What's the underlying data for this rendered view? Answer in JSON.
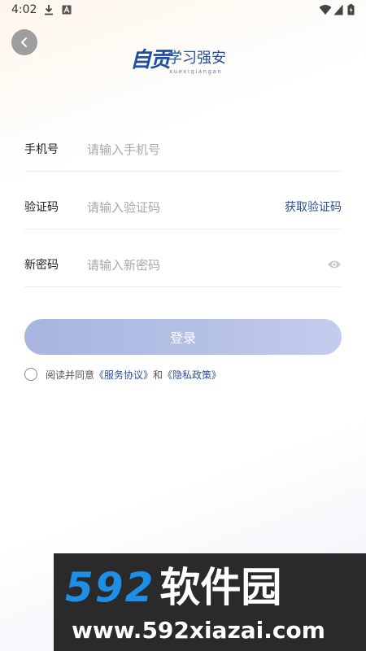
{
  "status_bar": {
    "time": "4:02"
  },
  "header": {
    "logo_mark": "自贡",
    "logo_name": "学习强安",
    "logo_sub": "xuexiqiangan"
  },
  "form": {
    "phone": {
      "label": "手机号",
      "placeholder": "请输入手机号"
    },
    "code": {
      "label": "验证码",
      "placeholder": "请输入验证码",
      "get_code_label": "获取验证码"
    },
    "password": {
      "label": "新密码",
      "placeholder": "请输入新密码"
    },
    "login_label": "登录",
    "agreement": {
      "prefix": "阅读并同意",
      "service_link": "《服务协议》",
      "conjunction": "和",
      "privacy_link": "《隐私政策》"
    }
  },
  "watermark": {
    "number": "592",
    "name": "软件园",
    "url": "www.592xiazai.com"
  },
  "colors": {
    "accent": "#2b4f9a",
    "button": "#b6c1e6",
    "watermark_blue": "#1e8fe6"
  }
}
